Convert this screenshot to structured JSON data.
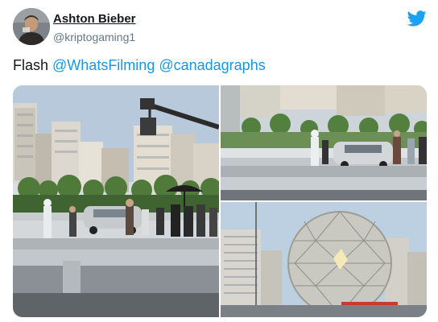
{
  "tweet": {
    "author_name": "Ashton Bieber",
    "author_handle": "@kriptogaming1",
    "text_prefix": "Flash ",
    "mentions": [
      "@WhatsFilming",
      "@canadagraphs"
    ]
  },
  "icons": {
    "brand": "twitter-bird-icon",
    "brand_color": "#1da1f2"
  },
  "colors": {
    "link": "#1b95e0",
    "text": "#14171a",
    "secondary": "#657786"
  }
}
